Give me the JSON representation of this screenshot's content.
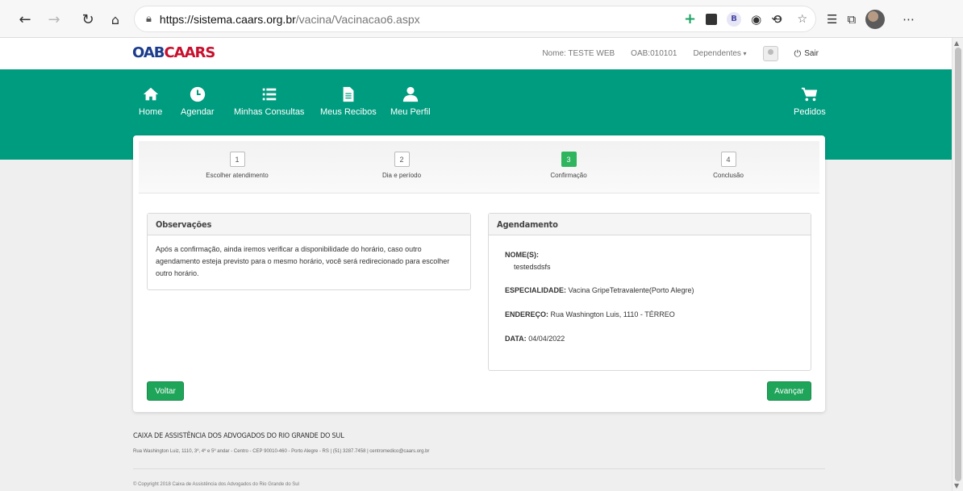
{
  "browser": {
    "url_host": "https://sistema.caars.org.br",
    "url_path": "/vacina/Vacinacao6.aspx"
  },
  "header": {
    "logo_brand_1": "OAB",
    "logo_brand_2": "CAARS",
    "user_name": "Nome: TESTE WEB",
    "oab_number": "OAB:010101",
    "dependents_label": "Dependentes",
    "logout_label": "Sair"
  },
  "nav": {
    "items": [
      {
        "label": "Home",
        "icon": "home-icon"
      },
      {
        "label": "Agendar",
        "icon": "clock-icon"
      },
      {
        "label": "Minhas Consultas",
        "icon": "list-icon"
      },
      {
        "label": "Meus Recibos",
        "icon": "document-icon"
      },
      {
        "label": "Meu Perfil",
        "icon": "user-icon"
      }
    ],
    "orders_label": "Pedidos"
  },
  "steps": [
    {
      "number": "1",
      "label": "Escolher atendimento",
      "active": false
    },
    {
      "number": "2",
      "label": "Dia e período",
      "active": false
    },
    {
      "number": "3",
      "label": "Confirmação",
      "active": true
    },
    {
      "number": "4",
      "label": "Conclusão",
      "active": false
    }
  ],
  "observacoes": {
    "title": "Observações",
    "text": "Após a confirmação, ainda iremos verificar a disponibilidade do horário, caso outro agendamento esteja previsto para o mesmo horário, você será redirecionado para escolher outro horário."
  },
  "agendamento": {
    "title": "Agendamento",
    "nomes_label": "NOME(S):",
    "nomes_value": "testedsdsfs",
    "especialidade_label": "ESPECIALIDADE:",
    "especialidade_value": "Vacina GripeTetravalente(Porto Alegre)",
    "endereco_label": "ENDEREÇO:",
    "endereco_value": "Rua Washington Luis, 1110 - TÉRREO",
    "data_label": "DATA:",
    "data_value": "04/04/2022"
  },
  "buttons": {
    "back": "Voltar",
    "next": "Avançar"
  },
  "footer": {
    "title": "CAIXA DE ASSISTÊNCIA DOS ADVOGADOS DO RIO GRANDE DO SUL",
    "address": "Rua Washington Luiz, 1110, 3º, 4º e 5º andar - Centro - CEP 90010-460 - Porto Alegre - RS | (51) 3287.7458 | centromedico@caars.org.br",
    "copyright": "© Copyright 2018 Caixa de Assistência dos Advogados do Rio Grande do Sul"
  },
  "colors": {
    "brand_green": "#009c7f",
    "button_green": "#1fa55a",
    "step_active": "#2fb55e"
  }
}
